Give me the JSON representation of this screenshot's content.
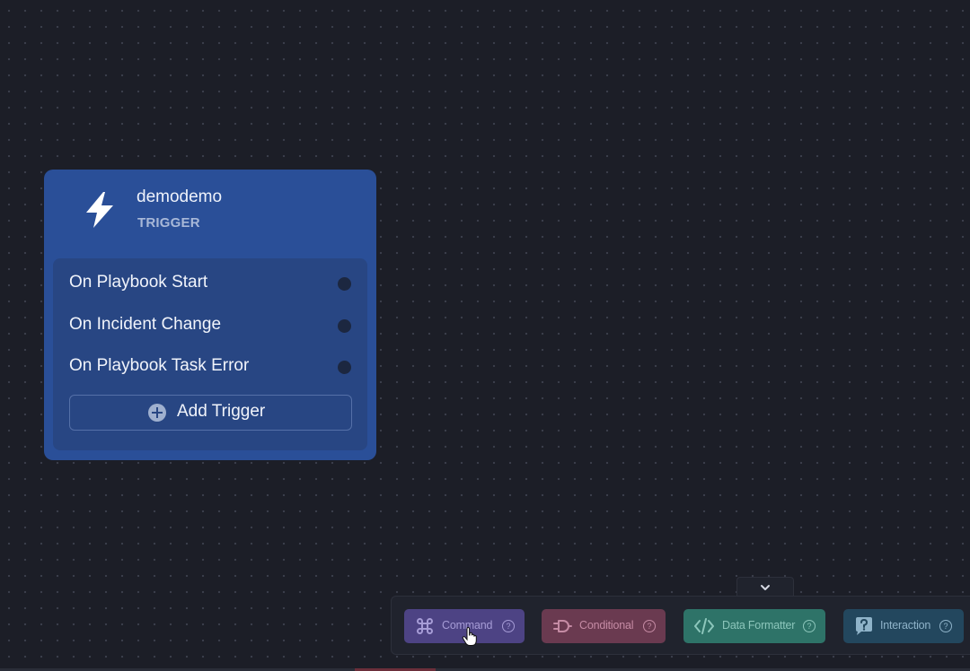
{
  "trigger_node": {
    "title": "demodemo",
    "subtitle": "TRIGGER",
    "icon": "lightning-bolt-icon",
    "color": "#2a4f98",
    "triggers": [
      {
        "label": "On Playbook Start"
      },
      {
        "label": "On Incident Change"
      },
      {
        "label": "On Playbook Task Error"
      }
    ],
    "add_label": "Add Trigger"
  },
  "palette": {
    "collapse_icon": "chevron-down-icon",
    "items": [
      {
        "label": "Command",
        "icon": "command-icon",
        "color": "#4d4384"
      },
      {
        "label": "Conditional",
        "icon": "logic-gate-icon",
        "color": "#6a3a50"
      },
      {
        "label": "Data Formatter",
        "icon": "code-icon",
        "color": "#2e7368"
      },
      {
        "label": "Interaction",
        "icon": "question-bubble-icon",
        "color": "#23475e"
      }
    ],
    "help_glyph": "?"
  }
}
